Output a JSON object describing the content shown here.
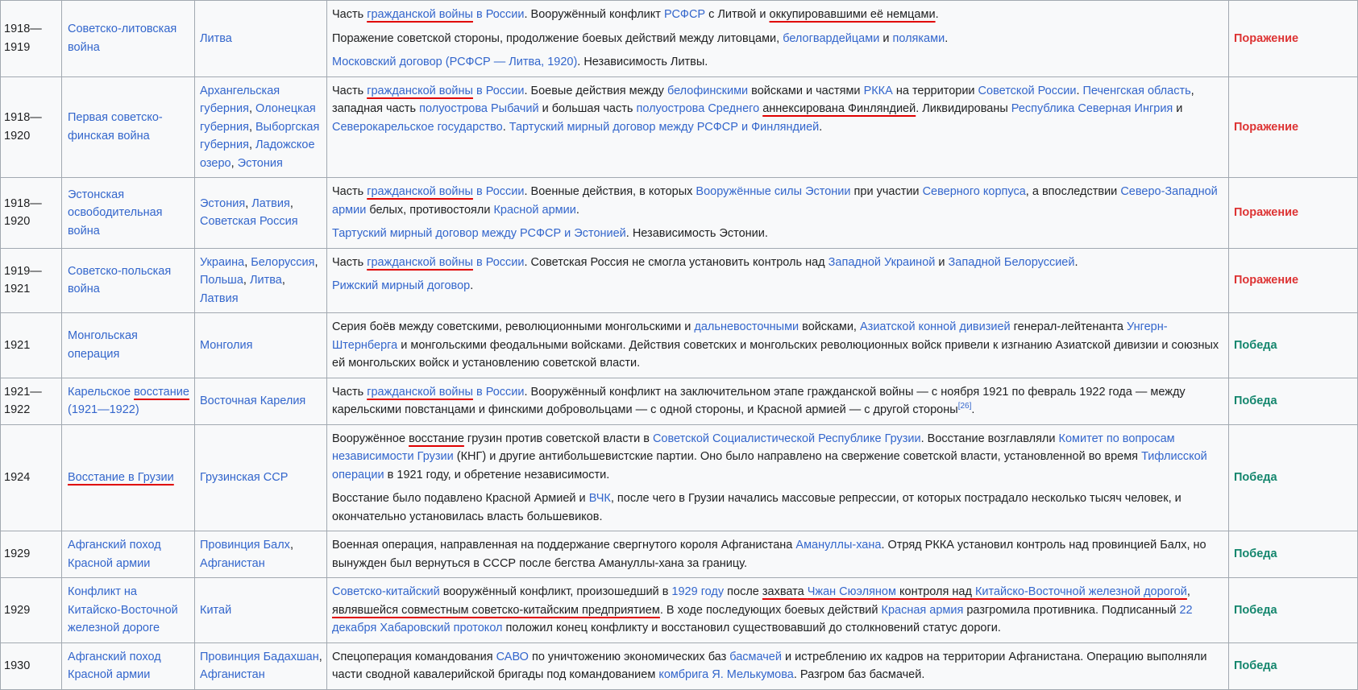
{
  "rows": [
    {
      "year": "1918—1919",
      "name": "Советско-литовская война",
      "place": "Литва",
      "result": "Поражение",
      "result_type": "loss",
      "paragraphs": [
        [
          {
            "t": "Часть "
          },
          {
            "t": "гражданской войны",
            "link": true,
            "ul": true
          },
          {
            "t": " в России",
            "link": true
          },
          {
            "t": ". Вооружённый конфликт "
          },
          {
            "t": "РСФСР",
            "link": true
          },
          {
            "t": " с Литвой и "
          },
          {
            "t": "оккупировавшими её немцами",
            "ul": true
          },
          {
            "t": "."
          }
        ],
        [
          {
            "t": "Поражение советской стороны, продолжение боевых действий между литовцами, "
          },
          {
            "t": "белогвардейцами",
            "link": true
          },
          {
            "t": " и "
          },
          {
            "t": "поляками",
            "link": true
          },
          {
            "t": "."
          }
        ],
        [
          {
            "t": "Московский договор (РСФСР — Литва, 1920)",
            "link": true
          },
          {
            "t": ". Независимость Литвы."
          }
        ]
      ]
    },
    {
      "year": "1918—1920",
      "name": "Первая советско-финская война",
      "place_parts": [
        {
          "t": "Архангельская губерния",
          "link": true
        },
        {
          "t": ", "
        },
        {
          "t": "Олонецкая губерния",
          "link": true
        },
        {
          "t": ", "
        },
        {
          "t": "Выборгская губерния",
          "link": true
        },
        {
          "t": ", "
        },
        {
          "t": "Ладожское озеро",
          "link": true
        },
        {
          "t": ", "
        },
        {
          "t": "Эстония",
          "link": true
        }
      ],
      "result": "Поражение",
      "result_type": "loss",
      "paragraphs": [
        [
          {
            "t": "Часть "
          },
          {
            "t": "гражданской войны",
            "link": true,
            "ul": true
          },
          {
            "t": " в России",
            "link": true
          },
          {
            "t": ". Боевые действия между "
          },
          {
            "t": "белофинскими",
            "link": true
          },
          {
            "t": " войсками и частями "
          },
          {
            "t": "РККА",
            "link": true
          },
          {
            "t": " на территории "
          },
          {
            "t": "Советской России",
            "link": true
          },
          {
            "t": ". "
          },
          {
            "t": "Печенгская область",
            "link": true
          },
          {
            "t": ", западная часть "
          },
          {
            "t": "полуострова Рыбачий",
            "link": true
          },
          {
            "t": " и большая часть "
          },
          {
            "t": "полуострова Среднего",
            "link": true
          },
          {
            "t": " "
          },
          {
            "t": "аннексирована Финляндией",
            "ul": true
          },
          {
            "t": ". Ликвидированы "
          },
          {
            "t": "Республика Северная Ингрия",
            "link": true
          },
          {
            "t": " и "
          },
          {
            "t": "Северокарельское государство",
            "link": true
          },
          {
            "t": ". "
          },
          {
            "t": "Тартуский мирный договор между РСФСР и Финляндией",
            "link": true
          },
          {
            "t": "."
          }
        ]
      ]
    },
    {
      "year": "1918—1920",
      "name": "Эстонская освободительная война",
      "place_parts": [
        {
          "t": "Эстония",
          "link": true
        },
        {
          "t": ", "
        },
        {
          "t": "Латвия",
          "link": true
        },
        {
          "t": ", "
        },
        {
          "t": "Советская Россия",
          "link": true
        }
      ],
      "result": "Поражение",
      "result_type": "loss",
      "paragraphs": [
        [
          {
            "t": "Часть "
          },
          {
            "t": "гражданской войны",
            "link": true,
            "ul": true
          },
          {
            "t": " в России",
            "link": true
          },
          {
            "t": ". Военные действия, в которых "
          },
          {
            "t": "Вооружённые силы Эстонии",
            "link": true
          },
          {
            "t": " при участии "
          },
          {
            "t": "Северного корпуса",
            "link": true
          },
          {
            "t": ", а впоследствии "
          },
          {
            "t": "Северо-Западной армии",
            "link": true
          },
          {
            "t": " белых, противостояли "
          },
          {
            "t": "Красной армии",
            "link": true
          },
          {
            "t": "."
          }
        ],
        [
          {
            "t": "Тартуский мирный договор между РСФСР и Эстонией",
            "link": true
          },
          {
            "t": ". Независимость Эстонии."
          }
        ]
      ]
    },
    {
      "year": "1919—1921",
      "name": "Советско-польская война",
      "place_parts": [
        {
          "t": "Украина",
          "link": true
        },
        {
          "t": ", "
        },
        {
          "t": "Белоруссия",
          "link": true
        },
        {
          "t": ", "
        },
        {
          "t": "Польша",
          "link": true
        },
        {
          "t": ", "
        },
        {
          "t": "Литва",
          "link": true
        },
        {
          "t": ", "
        },
        {
          "t": "Латвия",
          "link": true
        }
      ],
      "result": "Поражение",
      "result_type": "loss",
      "paragraphs": [
        [
          {
            "t": "Часть "
          },
          {
            "t": "гражданской войны",
            "link": true,
            "ul": true
          },
          {
            "t": " в России",
            "link": true
          },
          {
            "t": ". Советская Россия не смогла установить контроль над "
          },
          {
            "t": "Западной Украиной",
            "link": true
          },
          {
            "t": " и "
          },
          {
            "t": "Западной Белоруссией",
            "link": true
          },
          {
            "t": "."
          }
        ],
        [
          {
            "t": "Рижский мирный договор",
            "link": true
          },
          {
            "t": "."
          }
        ]
      ]
    },
    {
      "year": "1921",
      "name": "Монгольская операция",
      "place": "Монголия",
      "result": "Победа",
      "result_type": "win",
      "paragraphs": [
        [
          {
            "t": "Серия боёв между советскими, революционными монгольскими и "
          },
          {
            "t": "дальневосточными",
            "link": true
          },
          {
            "t": " войсками, "
          },
          {
            "t": "Азиатской конной дивизией",
            "link": true
          },
          {
            "t": " генерал-лейтенанта "
          },
          {
            "t": "Унгерн-Штернберга",
            "link": true
          },
          {
            "t": " и монгольскими феодальными войсками. Действия советских и монгольских революционных войск привели к изгнанию Азиатской дивизии и союзных ей монгольских войск и установлению советской власти."
          }
        ]
      ]
    },
    {
      "year": "1921—1922",
      "name_parts": [
        {
          "t": "Карельское "
        },
        {
          "t": "восстание",
          "ul": true
        },
        {
          "t": " (1921—1922)"
        }
      ],
      "place": "Восточная Карелия",
      "result": "Победа",
      "result_type": "win",
      "paragraphs": [
        [
          {
            "t": "Часть "
          },
          {
            "t": "гражданской войны",
            "link": true,
            "ul": true
          },
          {
            "t": " в России",
            "link": true
          },
          {
            "t": ". Вооружённый конфликт на заключительном этапе гражданской войны — с ноября 1921 по февраль 1922 года — между карельскими повстанцами и финскими добровольцами — с одной стороны, и Красной армией — с другой стороны"
          },
          {
            "t": "[26]",
            "link": true,
            "sup": true
          },
          {
            "t": "."
          }
        ]
      ]
    },
    {
      "year": "1924",
      "name_parts": [
        {
          "t": "Восстание",
          "ul": true
        },
        {
          "t": " в Грузии",
          "ul": true
        }
      ],
      "place": "Грузинская ССР",
      "result": "Победа",
      "result_type": "win",
      "paragraphs": [
        [
          {
            "t": "Вооружённое ",
            "plain": true
          },
          {
            "t": "восстание",
            "plain": true,
            "ul": true
          },
          {
            "t": " грузин против советской власти в ",
            "plain": true
          },
          {
            "t": "Советской Социалистической Республике Грузии",
            "link": true
          },
          {
            "t": ". Восстание возглавляли "
          },
          {
            "t": "Комитет по вопросам независимости Грузии",
            "link": true
          },
          {
            "t": " (КНГ) и другие антибольшевистские партии. Оно было направлено на свержение советской власти, установленной во время "
          },
          {
            "t": "Тифлисской операции",
            "link": true
          },
          {
            "t": " в 1921 году, и обретение независимости."
          }
        ],
        [
          {
            "t": "Восстание было подавлено Красной Армией и "
          },
          {
            "t": "ВЧК",
            "link": true
          },
          {
            "t": ", после чего в Грузии начались массовые репрессии, от которых пострадало несколько тысяч человек, и окончательно установилась власть большевиков."
          }
        ]
      ]
    },
    {
      "year": "1929",
      "name": "Афганский поход Красной армии",
      "place_parts": [
        {
          "t": "Провинция Балх",
          "link": true
        },
        {
          "t": ", "
        },
        {
          "t": "Афганистан",
          "link": true
        }
      ],
      "result": "Победа",
      "result_type": "win",
      "paragraphs": [
        [
          {
            "t": "Военная операция, направленная на поддержание свергнутого короля Афганистана "
          },
          {
            "t": "Амануллы-хана",
            "link": true
          },
          {
            "t": ". Отряд РККА установил контроль над провинцией Балх, но вынужден был вернуться в СССР после бегства Амануллы-хана за границу."
          }
        ]
      ]
    },
    {
      "year": "1929",
      "name": "Конфликт на Китайско-Восточной железной дороге",
      "place": "Китай",
      "result": "Победа",
      "result_type": "win",
      "paragraphs": [
        [
          {
            "t": "Советско-китайский",
            "link": true
          },
          {
            "t": " вооружённый конфликт, произошедший в "
          },
          {
            "t": "1929 году",
            "link": true
          },
          {
            "t": " после "
          },
          {
            "t": "захвата ",
            "ul": true
          },
          {
            "t": "Чжан Сюэляном",
            "link": true,
            "ul": true
          },
          {
            "t": " контроля над ",
            "ul": true
          },
          {
            "t": "Китайско-Восточной железной дорогой",
            "link": true,
            "ul": true
          },
          {
            "t": ", "
          },
          {
            "t": "являвшейся совместным советско-китайским предприятием",
            "ul": true
          },
          {
            "t": ". В ходе последующих боевых действий "
          },
          {
            "t": "Красная армия",
            "link": true
          },
          {
            "t": " разгромила противника. Подписанный "
          },
          {
            "t": "22 декабря",
            "link": true
          },
          {
            "t": " "
          },
          {
            "t": "Хабаровский протокол",
            "link": true
          },
          {
            "t": " положил конец конфликту и восстановил существовавший до столкновений статус дороги."
          }
        ]
      ]
    },
    {
      "year": "1930",
      "name": "Афганский поход Красной армии",
      "place_parts": [
        {
          "t": "Провинция Бадахшан",
          "link": true
        },
        {
          "t": ", "
        },
        {
          "t": "Афганистан",
          "link": true
        }
      ],
      "result": "Победа",
      "result_type": "win",
      "paragraphs": [
        [
          {
            "t": "Спецоперация командования "
          },
          {
            "t": "САВО",
            "link": true
          },
          {
            "t": " по уничтожению экономических баз "
          },
          {
            "t": "басмачей",
            "link": true
          },
          {
            "t": " и истреблению их кадров на территории Афганистана. Операцию выполняли части сводной кавалерийской бригады под командованием "
          },
          {
            "t": "комбрига Я. Мелькумова",
            "link": true
          },
          {
            "t": ". Разгром баз басмачей."
          }
        ]
      ]
    }
  ]
}
